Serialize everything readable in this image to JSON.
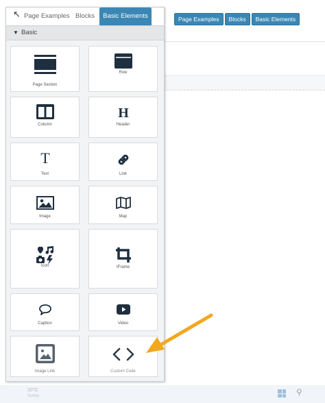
{
  "panel": {
    "tabs": [
      {
        "label": "Page Examples"
      },
      {
        "label": "Blocks"
      },
      {
        "label": "Basic Elements"
      }
    ],
    "section": {
      "label": "Basic"
    },
    "elements": [
      {
        "label": "Page Section",
        "icon": "page-section-icon"
      },
      {
        "label": "Row",
        "icon": "row-icon"
      },
      {
        "label": "Column",
        "icon": "column-icon"
      },
      {
        "label": "Header",
        "icon": "header-icon"
      },
      {
        "label": "Text",
        "icon": "text-icon"
      },
      {
        "label": "Link",
        "icon": "link-icon"
      },
      {
        "label": "Image",
        "icon": "image-icon"
      },
      {
        "label": "Map",
        "icon": "map-icon"
      },
      {
        "label": "Icon",
        "icon": "icon-icon"
      },
      {
        "label": "IFrame",
        "icon": "iframe-icon"
      },
      {
        "label": "Caption",
        "icon": "caption-icon"
      },
      {
        "label": "Video",
        "icon": "video-icon"
      },
      {
        "label": "Image Link",
        "icon": "image-link-icon"
      },
      {
        "label": "Custom Code",
        "icon": "custom-code-icon"
      }
    ]
  },
  "canvas": {
    "tabs": [
      {
        "label": "Page Examples"
      },
      {
        "label": "Blocks"
      },
      {
        "label": "Basic Elements"
      }
    ]
  },
  "taskbar": {
    "temperature": "10°C",
    "condition": "Sunny"
  },
  "colors": {
    "accent": "#3b87b4",
    "icon": "#1f2f3f",
    "arrow": "#f2a81d"
  }
}
